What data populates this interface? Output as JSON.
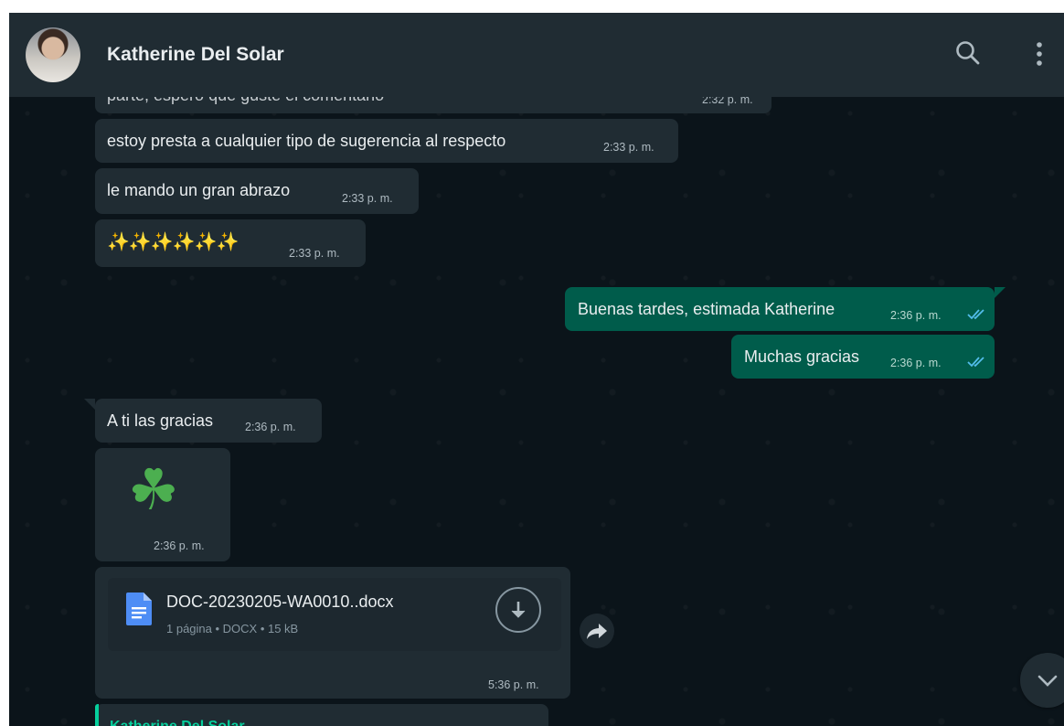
{
  "header": {
    "contact_name": "Katherine Del Solar"
  },
  "messages": [
    {
      "text": "parte, espero que guste el comentario",
      "time": "2:32 p. m.",
      "dir": "in"
    },
    {
      "text": "estoy presta a cualquier tipo de sugerencia al respecto",
      "time": "2:33 p. m.",
      "dir": "in"
    },
    {
      "text": "le mando un gran abrazo",
      "time": "2:33 p. m.",
      "dir": "in"
    },
    {
      "text": "✨✨✨✨✨✨",
      "time": "2:33 p. m.",
      "dir": "in"
    },
    {
      "text": "Buenas tardes, estimada Katherine",
      "time": "2:36 p. m.",
      "dir": "out",
      "status": "read"
    },
    {
      "text": "Muchas gracias",
      "time": "2:36 p. m.",
      "dir": "out",
      "status": "read"
    },
    {
      "text": "A ti las gracias",
      "time": "2:36 p. m.",
      "dir": "in"
    },
    {
      "emoji": "☘",
      "time": "2:36 p. m.",
      "dir": "in"
    },
    {
      "document": {
        "filename": "DOC-20230205-WA0010..docx",
        "meta": "1 página • DOCX • 15 kB"
      },
      "time": "5:36 p. m.",
      "dir": "in"
    }
  ],
  "partial_quote": {
    "sender": "Katherine Del Solar"
  },
  "colors": {
    "chat_background": "#0b141a",
    "header": "#202c33",
    "incoming_bubble": "#202c33",
    "outgoing_bubble": "#005c4b",
    "read_ticks": "#53bdeb",
    "quote_accent": "#06cf9c"
  },
  "icons": [
    "search-icon",
    "menu-icon",
    "document-icon",
    "download-icon",
    "forward-icon",
    "chevron-down-icon"
  ]
}
